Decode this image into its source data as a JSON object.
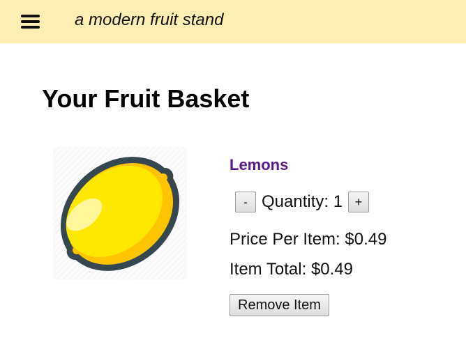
{
  "header": {
    "menu_icon": "hamburger-menu-icon",
    "site_title": "a modern fruit stand",
    "background_color": "#fdeeb3"
  },
  "main": {
    "page_title": "Your Fruit Basket",
    "basket_items": [
      {
        "image_icon": "lemon-icon",
        "name": "Lemons",
        "name_color": "#5b1a8b",
        "decrement_label": "-",
        "quantity_label": "Quantity: 1",
        "increment_label": "+",
        "price_per_item": "Price Per Item: $0.49",
        "item_total": "Item Total: $0.49",
        "remove_label": "Remove Item"
      }
    ]
  }
}
